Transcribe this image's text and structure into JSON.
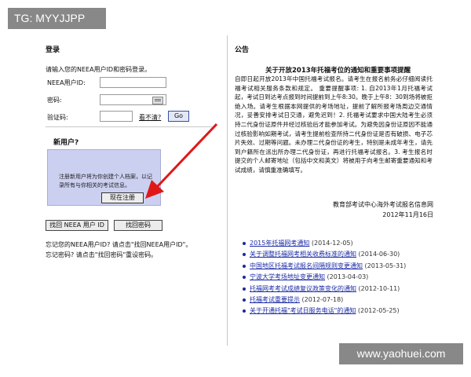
{
  "watermark_top": "TG: MYYJJPP",
  "watermark_bottom": "www.yaohuei.com",
  "login": {
    "heading": "登录",
    "prompt": "请输入您的NEEA用户ID和密码登录。",
    "userid_label": "NEEA用户ID:",
    "password_label": "密码:",
    "captcha_label": "验证码:",
    "captcha_help": "看不清?",
    "go_label": "Go"
  },
  "new_user": {
    "heading": "新用户?",
    "description": "注册新用户将为你创建个人档案，以记录所有与你相关的考试信息。",
    "register_label": "现在注册"
  },
  "buttons": {
    "find_id": "找回 NEEA 用户 ID",
    "find_password": "找回密码"
  },
  "help_lines": [
    "忘记您的NEEA用户ID? 请点击\"找回NEEA用户ID\"。",
    "忘记密码? 请点击\"找回密码\"重设密码。"
  ],
  "announcement": {
    "heading": "公告",
    "title": "关于开放2013年托福考位的通知和重要事项提醒",
    "body": "自即日起开放2013年中国托福考试报名。请考生在报名前务必仔细阅读托福考试相关服务条款和规定。 重要提醒事项: 1. 自2013年1月托福考试起，考试日到达考点报到时间提前到上午8:30。晚于上午8：30到场将被拒绝入场。请考生根据本网提供的考场地址，提前了解所报考场周边交通情况，妥善安排考试日交通，避免迟到！2. 托福考试要求中国大陆考生必须持二代身份证原件并经过核验后才能参加考试。为避免因身份证原因不能通过核验影响如期考试，请考生提前检查所持二代身份证是否有破损、电子芯片失效、过期等问题。未办理二代身份证的考生，特别是未成年考生，请先到户籍所在派出所办理二代身份证，再进行托福考试报名。3. 考生报名时提交的个人邮寄地址（包括中文和英文）将被用于向考生邮寄重要通知和考试成绩，请慎重准确填写。",
    "signature": "教育部考试中心海外考试报名信息网",
    "date": "2012年11月16日"
  },
  "news": [
    {
      "title": "2015年托福网考通知",
      "date": "(2014-12-05)"
    },
    {
      "title": "关于调整托福网考相关收费标准的通知",
      "date": "(2014-06-30)"
    },
    {
      "title": "中国地区托福考试报名间隔规则变更通知",
      "date": "(2013-05-31)"
    },
    {
      "title": "宁波大学考场地址变更通知",
      "date": "(2013-04-03)"
    },
    {
      "title": "托福网考考试成绩复议政策变化的通知",
      "date": "(2012-10-11)"
    },
    {
      "title": "托福考试重要提示",
      "date": "(2012-07-18)"
    },
    {
      "title": "关于开通托福\"考试日服务电话\"的通知",
      "date": "(2012-05-25)"
    }
  ]
}
